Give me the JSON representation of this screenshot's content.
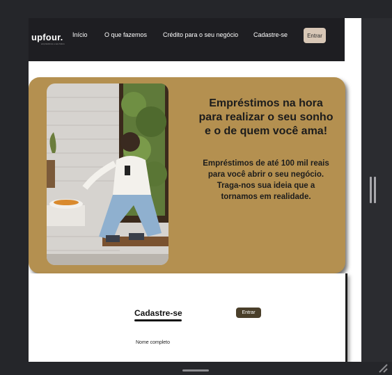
{
  "brand": {
    "name": "upfour",
    "tagline": "empréstimos e seu futuro"
  },
  "nav": {
    "items": [
      {
        "label": "Início"
      },
      {
        "label": "O que fazemos"
      },
      {
        "label": "Crédito para o seu negócio"
      },
      {
        "label": "Cadastre-se"
      }
    ],
    "login_label": "Entrar"
  },
  "hero": {
    "title_lines": [
      "Empréstimos na hora",
      "para realizar o seu sonho",
      "e o de quem você ama!"
    ],
    "subtitle_lines": [
      "Empréstimos de até 100 mil reais",
      "para você abrir o seu negócio.",
      "Traga-nos sua ideia que a",
      "tornamos em realidade."
    ]
  },
  "signup": {
    "title": "Cadastre-se",
    "login_label": "Entrar",
    "field_label": "Nome completo"
  },
  "colors": {
    "hero_bg": "#b49050",
    "navbar_bg": "#1e1e22",
    "login_btn": "#d8c7b6"
  }
}
